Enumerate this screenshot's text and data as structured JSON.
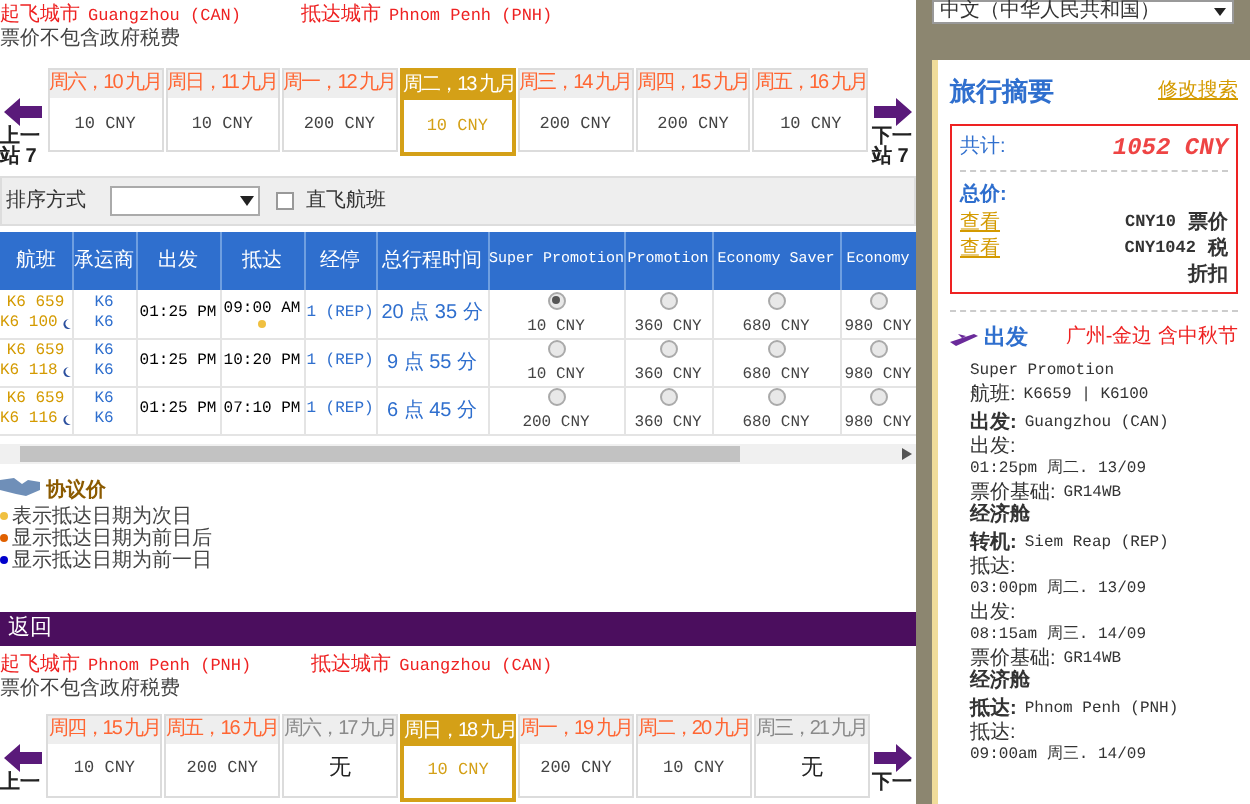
{
  "outbound": {
    "from_label": "起飞城市",
    "from": "Guangzhou (CAN)",
    "to_label": "抵达城市",
    "to": "Phnom Penh (PNH)",
    "note": "票价不包含政府税费",
    "prev_label": "上一站 7",
    "next_label": "下一站 7",
    "dates": [
      {
        "label": "周六，10 九月",
        "price": "10 CNY",
        "selected": false,
        "available": true
      },
      {
        "label": "周日，11 九月",
        "price": "10 CNY",
        "selected": false,
        "available": true
      },
      {
        "label": "周一，12 九月",
        "price": "200 CNY",
        "selected": false,
        "available": true
      },
      {
        "label": "周二，13 九月",
        "price": "10 CNY",
        "selected": true,
        "available": true
      },
      {
        "label": "周三，14 九月",
        "price": "200 CNY",
        "selected": false,
        "available": true
      },
      {
        "label": "周四，15 九月",
        "price": "200 CNY",
        "selected": false,
        "available": true
      },
      {
        "label": "周五，16 九月",
        "price": "10 CNY",
        "selected": false,
        "available": true
      }
    ]
  },
  "sort": {
    "label": "排序方式",
    "direct_label": "直飞航班",
    "direct_checked": false
  },
  "table": {
    "columns": [
      "航班",
      "承运商",
      "出发",
      "抵达",
      "经停",
      "总行程时间",
      "Super Promotion",
      "Promotion",
      "Economy Saver",
      "Economy"
    ],
    "rows": [
      {
        "flights": [
          "K6 659",
          "K6 100"
        ],
        "overnight": true,
        "carriers": [
          "K6",
          "K6"
        ],
        "depart": "01:25 PM",
        "arrive": "09:00 AM",
        "next_day": true,
        "stops": "1 (REP)",
        "duration": "20 点 35 分",
        "fares": [
          {
            "price": "10 CNY",
            "selected": true
          },
          {
            "price": "360 CNY",
            "selected": false
          },
          {
            "price": "680 CNY",
            "selected": false
          },
          {
            "price": "980 CNY",
            "selected": false
          }
        ]
      },
      {
        "flights": [
          "K6 659",
          "K6 118"
        ],
        "overnight": true,
        "carriers": [
          "K6",
          "K6"
        ],
        "depart": "01:25 PM",
        "arrive": "10:20 PM",
        "next_day": false,
        "stops": "1 (REP)",
        "duration": "9 点 55 分",
        "fares": [
          {
            "price": "10 CNY",
            "selected": false
          },
          {
            "price": "360 CNY",
            "selected": false
          },
          {
            "price": "680 CNY",
            "selected": false
          },
          {
            "price": "980 CNY",
            "selected": false
          }
        ]
      },
      {
        "flights": [
          "K6 659",
          "K6 116"
        ],
        "overnight": true,
        "carriers": [
          "K6",
          "K6"
        ],
        "depart": "01:25 PM",
        "arrive": "07:10 PM",
        "next_day": false,
        "stops": "1 (REP)",
        "duration": "6 点 45 分",
        "fares": [
          {
            "price": "200 CNY",
            "selected": false
          },
          {
            "price": "360 CNY",
            "selected": false
          },
          {
            "price": "680 CNY",
            "selected": false
          },
          {
            "price": "980 CNY",
            "selected": false
          }
        ]
      }
    ]
  },
  "legend": {
    "title": "协议价",
    "items": [
      {
        "text": "表示抵达日期为次日",
        "color": "#f0c040"
      },
      {
        "text": "显示抵达日期为前日后",
        "color": "#e06000"
      },
      {
        "text": "显示抵达日期为前一日",
        "color": "#0000cc"
      }
    ]
  },
  "return": {
    "title": "返回",
    "from_label": "起飞城市",
    "from": "Phnom Penh (PNH)",
    "to_label": "抵达城市",
    "to": "Guangzhou (CAN)",
    "note": "票价不包含政府税费",
    "prev_label": "上一",
    "next_label": "下一",
    "dates": [
      {
        "label": "周四，15 九月",
        "price": "10 CNY",
        "selected": false,
        "available": true
      },
      {
        "label": "周五，16 九月",
        "price": "200 CNY",
        "selected": false,
        "available": true
      },
      {
        "label": "周六，17 九月",
        "price": "无",
        "selected": false,
        "available": false
      },
      {
        "label": "周日，18 九月",
        "price": "10 CNY",
        "selected": true,
        "available": true
      },
      {
        "label": "周一，19 九月",
        "price": "200 CNY",
        "selected": false,
        "available": true
      },
      {
        "label": "周二，20 九月",
        "price": "10 CNY",
        "selected": false,
        "available": true
      },
      {
        "label": "周三，21 九月",
        "price": "无",
        "selected": false,
        "available": false
      }
    ]
  },
  "language": "中文（中华人民共和国）",
  "summary": {
    "title": "旅行摘要",
    "edit_link": "修改搜索",
    "total_label": "共计:",
    "total": "1052 CNY",
    "price_label": "总价:",
    "lines": [
      {
        "link": "查看",
        "amount": "CNY10",
        "label": "票价"
      },
      {
        "link": "查看",
        "amount": "CNY1042",
        "label": "税"
      },
      {
        "label": "折扣"
      }
    ],
    "segment": {
      "title": "出发",
      "route": "广州-金边 含中秋节",
      "fare_class": "Super Promotion",
      "items": [
        {
          "kind": "inline",
          "label": "航班:",
          "value": "K6659 | K6100"
        },
        {
          "kind": "heading",
          "label": "出发:",
          "value": "Guangzhou (CAN)"
        },
        {
          "kind": "time",
          "label": "出发:",
          "value": "01:25pm 周二. 13/09"
        },
        {
          "kind": "inline",
          "label": "票价基础:",
          "value": "GR14WB"
        },
        {
          "kind": "cabin",
          "label": "经济舱"
        },
        {
          "kind": "heading",
          "label": "转机:",
          "value": "Siem Reap (REP)"
        },
        {
          "kind": "time",
          "label": "抵达:",
          "value": "03:00pm 周二. 13/09"
        },
        {
          "kind": "time",
          "label": "出发:",
          "value": "08:15am 周三. 14/09"
        },
        {
          "kind": "inline",
          "label": "票价基础:",
          "value": "GR14WB"
        },
        {
          "kind": "cabin",
          "label": "经济舱"
        },
        {
          "kind": "heading",
          "label": "抵达:",
          "value": "Phnom Penh (PNH)"
        },
        {
          "kind": "time",
          "label": "抵达:",
          "value": "09:00am 周三. 14/09"
        }
      ]
    }
  }
}
